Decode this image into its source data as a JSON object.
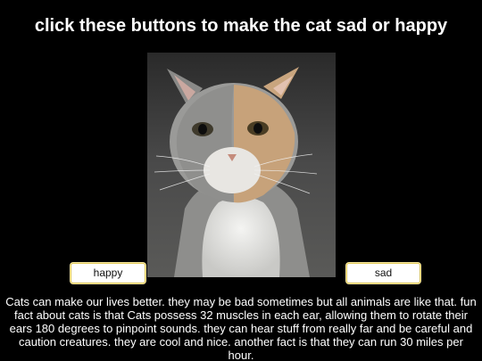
{
  "page": {
    "title": "click these buttons to make the cat sad or happy"
  },
  "photo": {
    "subject": "cat",
    "icon": "cat-photo"
  },
  "buttons": {
    "happy_label": "happy",
    "sad_label": "sad"
  },
  "caption": {
    "text": "Cats can make our lives better. they may be bad sometimes but all animals are like that. fun fact about cats is that Cats possess 32 muscles in each ear, allowing them to rotate their ears 180 degrees to pinpoint sounds. they can hear stuff from really far and be careful and caution creatures. they are cool and nice. another fact is that they can run 30 miles per hour."
  },
  "colors": {
    "background": "#000000",
    "text": "#ffffff",
    "button_background": "#ffffff",
    "button_border": "#e0c95a"
  }
}
